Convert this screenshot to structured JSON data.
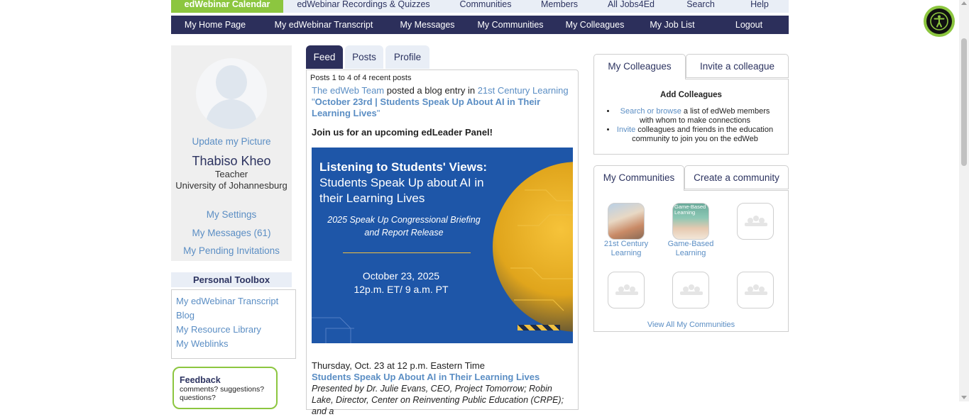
{
  "top_nav": [
    "edWebinar Calendar",
    "edWebinar Recordings & Quizzes",
    "Communities",
    "Members",
    "All Jobs4Ed",
    "Search",
    "Help"
  ],
  "sub_nav": [
    "My Home Page",
    "My edWebinar Transcript",
    "My Messages",
    "My Communities",
    "My Colleagues",
    "My Job List",
    "Logout"
  ],
  "profile": {
    "update_picture": "Update my Picture",
    "name": "Thabiso Kheo",
    "role": "Teacher",
    "org": "University of Johannesburg",
    "links": [
      "My Settings",
      "My Messages (61)",
      "My Pending Invitations"
    ]
  },
  "toolbox": {
    "title": "Personal Toolbox",
    "links": [
      "My edWebinar Transcript",
      "Blog",
      "My Resource Library",
      "My Weblinks"
    ]
  },
  "feedback": {
    "title": "Feedback",
    "text1": "comments? suggestions?",
    "text2": "questions?"
  },
  "feed": {
    "tabs": [
      "Feed",
      "Posts",
      "Profile"
    ],
    "post_count": "Posts 1 to 4 of 4 recent posts",
    "author": "The edWeb Team",
    "action": "posted a blog entry in",
    "community": "21st Century Learning",
    "post_title": "October 23rd | Students Speak Up About AI in Their Learning Lives",
    "join_text": "Join us for an upcoming edLeader Panel!",
    "banner": {
      "line1": "Listening to Students' Views:",
      "line2": "Students Speak Up about AI in their Learning Lives",
      "line3": "2025 Speak Up Congressional Briefing and Report Release",
      "line4": "October 23, 2025",
      "line5": "12p.m. ET/ 9 a.m. PT"
    },
    "event_date": "Thursday, Oct. 23 at 12 p.m. Eastern Time",
    "event_title": "Students Speak Up About AI in Their Learning Lives",
    "presenters": "Presented by Dr. Julie Evans, CEO, Project Tomorrow; Robin Lake, Director, Center on Reinventing Public Education (CRPE); and a"
  },
  "colleagues": {
    "tab_active": "My Colleagues",
    "tab_inactive": "Invite a colleague",
    "heading": "Add Colleagues",
    "item1_link": "Search or browse",
    "item1_text": "a list of edWeb members with whom to make connections",
    "item2_link": "Invite",
    "item2_text": "colleagues and friends in the education community to join you on the edWeb"
  },
  "communities": {
    "tab_active": "My Communities",
    "tab_inactive": "Create a community",
    "items": [
      "21st Century Learning",
      "Game-Based Learning"
    ],
    "game_based_icon_text": "Game-Based Learning",
    "view_all": "View All My Communities"
  },
  "colors": {
    "navy": "#2c2f5b",
    "green": "#8cc63f",
    "link": "#5b8ec4",
    "light_blue": "#e9eef6"
  }
}
